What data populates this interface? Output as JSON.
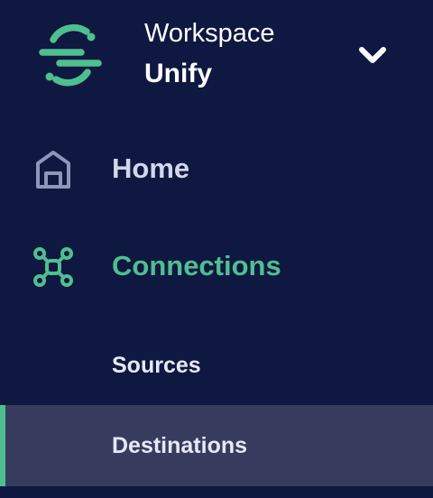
{
  "workspace": {
    "label": "Workspace",
    "name": "Unify",
    "logo_icon": "segment-logo-icon",
    "dropdown_icon": "chevron-down-icon"
  },
  "nav": {
    "items": [
      {
        "label": "Home",
        "icon": "home-icon",
        "active": false
      },
      {
        "label": "Connections",
        "icon": "connections-icon",
        "active": true
      }
    ],
    "sub_items": [
      {
        "label": "Sources",
        "selected": false
      },
      {
        "label": "Destinations",
        "selected": true
      }
    ]
  },
  "colors": {
    "background": "#0f1840",
    "accent": "#4fbf8f",
    "selected_background": "#373c5f",
    "nav_text": "#d2d6ec",
    "icon_muted": "#8e97b8"
  }
}
